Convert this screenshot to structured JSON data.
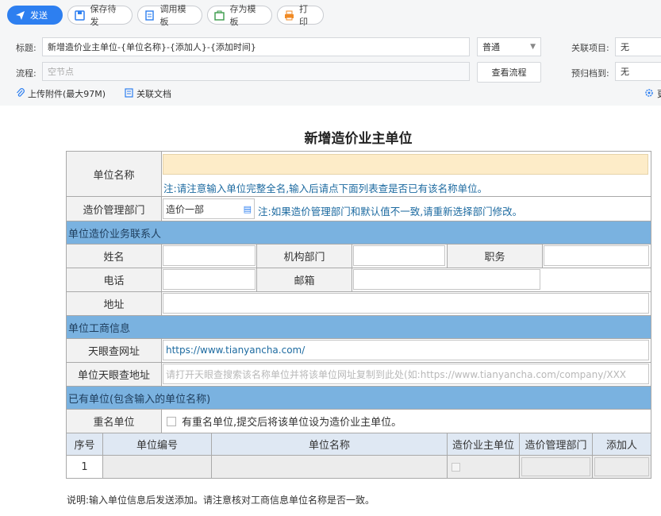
{
  "toolbar": {
    "send": "发送",
    "save_draft": "保存待发",
    "load_template": "调用模板",
    "save_template": "存为模板",
    "print": "打印"
  },
  "header": {
    "title_label": "标题:",
    "title_value": "新增造价业主单位-{单位名称}-{添加人}-{添加时间}",
    "priority": "普通",
    "related_label": "关联项目:",
    "related_value": "无",
    "flow_label": "流程:",
    "flow_placeholder": "空节点",
    "view_flow": "查看流程",
    "archive_label": "预归档到:",
    "archive_value": "无",
    "upload": "上传附件(最大97M)",
    "related_doc": "关联文档",
    "more": "更"
  },
  "form": {
    "title": "新增造价业主单位",
    "unit_name_label": "单位名称",
    "unit_name_note": "注:请注意输入单位完整全名,输入后请点下面列表查是否已有该名称单位。",
    "dept_label": "造价管理部门",
    "dept_value": "造价一部",
    "dept_note": "注:如果造价管理部门和默认值不一致,请重新选择部门修改。",
    "contact_section": "单位造价业务联系人",
    "name_label": "姓名",
    "org_dept_label": "机构部门",
    "position_label": "职务",
    "phone_label": "电话",
    "email_label": "邮箱",
    "address_label": "地址",
    "biz_section": "单位工商信息",
    "tyc_label": "天眼查网址",
    "tyc_value": "https://www.tianyancha.com/",
    "tyc_addr_label": "单位天眼查地址",
    "tyc_addr_placeholder": "请打开天眼查搜索该名称单位并将该单位网址复制到此处(如:https://www.tianyancha.com/company/XXX",
    "existing_section": "已有单位(包含输入的单位名称)",
    "dup_label": "重名单位",
    "dup_text": "有重名单位,提交后将该单位设为造价业主单位。",
    "table_headers": [
      "序号",
      "单位编号",
      "单位名称",
      "造价业主单位",
      "造价管理部门",
      "添加人"
    ],
    "table_rows": [
      {
        "index": "1"
      }
    ],
    "footer": "说明:输入单位信息后发送添加。请注意核对工商信息单位名称是否一致。"
  },
  "colors": {
    "accent": "#2d7ff0",
    "section": "#7ab2e0",
    "highlight": "#fdecc8",
    "note": "#1c6aa0"
  }
}
